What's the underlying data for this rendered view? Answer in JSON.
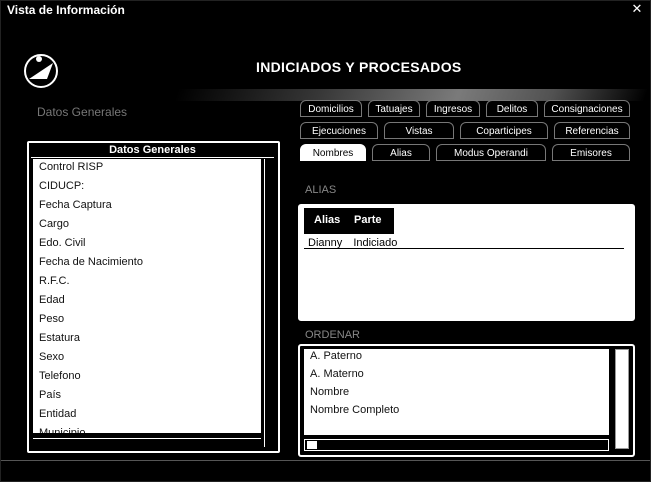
{
  "window": {
    "title": "Vista de Información",
    "close_icon": "close-icon"
  },
  "banner": {
    "title": "INDICIADOS Y PROCESADOS"
  },
  "left_panel": {
    "label": "Datos Generales",
    "header": "Datos Generales",
    "items": [
      "Control RISP",
      "CIDUCP:",
      "Fecha Captura",
      "Cargo",
      "Edo. Civil",
      "Fecha de Nacimiento",
      "R.F.C.",
      "Edad",
      "Peso",
      "Estatura",
      "Sexo",
      "Telefono",
      "País",
      "Entidad",
      "Municipio"
    ]
  },
  "tabs": {
    "row1": [
      "Domicilios",
      "Tatuajes",
      "Ingresos",
      "Delitos",
      "Consignaciones"
    ],
    "row2": [
      "Ejecuciones",
      "Vistas",
      "Coparticipes",
      "Referencias"
    ],
    "row3": [
      "Nombres",
      "Alias",
      "Modus Operandi",
      "Emisores"
    ],
    "active": "Nombres"
  },
  "alias_section": {
    "label": "ALIAS",
    "columns": [
      "Alias",
      "Parte"
    ],
    "row": [
      "Dianny",
      "Indiciado"
    ]
  },
  "sort_section": {
    "label": "ORDENAR",
    "items": [
      "A. Paterno",
      "A. Materno",
      "Nombre",
      "Nombre Completo"
    ]
  },
  "colors": {
    "background": "#000000",
    "panel": "#ffffff",
    "text_light": "#ffffff"
  }
}
